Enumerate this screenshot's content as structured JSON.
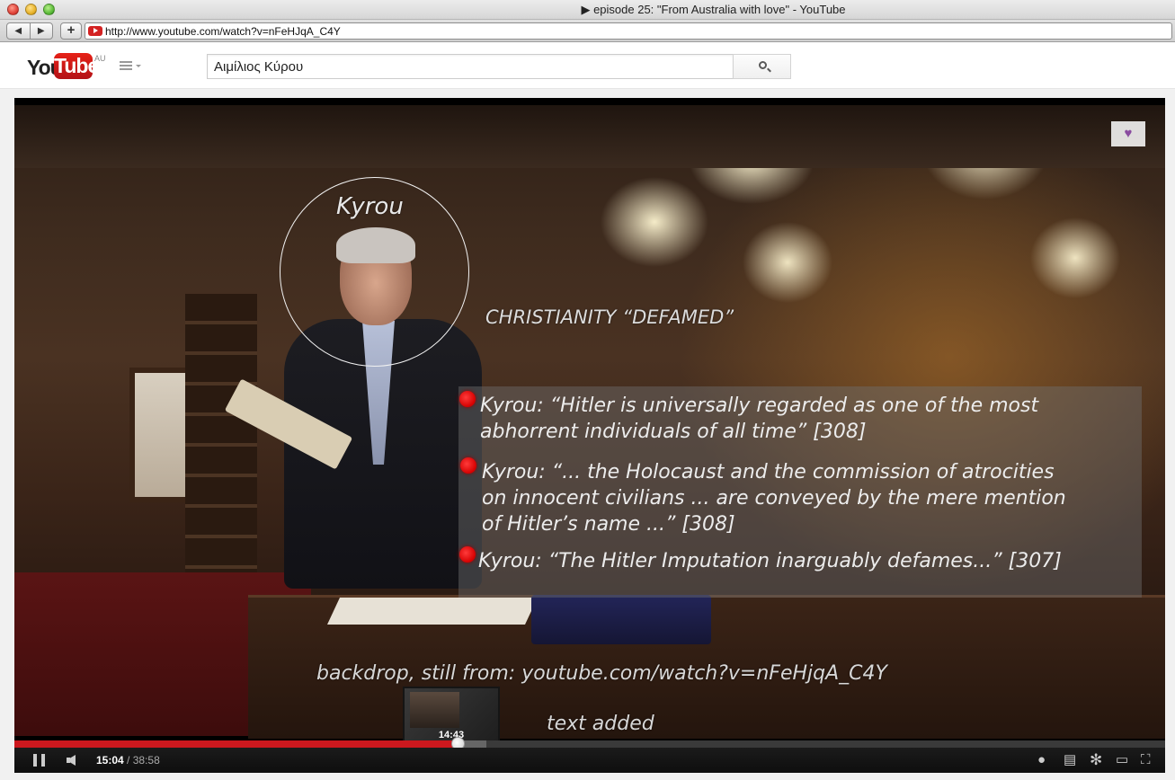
{
  "window": {
    "title": "▶ episode 25: \"From Australia with love\" - YouTube"
  },
  "browser": {
    "back": "◀",
    "forward": "▶",
    "add": "+",
    "url": "http://www.youtube.com/watch?v=nFeHJqA_C4Y"
  },
  "youtube": {
    "logo_you": "You",
    "logo_tube": "Tube",
    "region": "AU",
    "search_value": "Αιμίλιος Κύρου"
  },
  "overlay": {
    "name": "Kyrou",
    "heading": "CHRISTIANITY “DEFAMED”",
    "quotes": [
      {
        "line1": "Kyrou: “Hitler is universally regarded as one of the most",
        "line2": "abhorrent individuals of all time” [308]",
        "line3": ""
      },
      {
        "line1": "Kyrou: “... the Holocaust and the commission of atrocities",
        "line2": "on innocent civilians ... are conveyed by the mere mention",
        "line3": "of Hitler’s name ...” [308]"
      },
      {
        "line1": "Kyrou: “The Hitler Imputation inarguably defames...” [307]",
        "line2": "",
        "line3": ""
      }
    ],
    "backdrop": "backdrop, still from: youtube.com/watch?v=nFeHjqA_C4Y",
    "added": "text added",
    "badge_icon": "heart-icon"
  },
  "player": {
    "current_time": "15:04",
    "separator": " / ",
    "duration": "38:58",
    "preview_time": "14:43",
    "played_fraction": 0.386,
    "loaded_fraction": 0.41,
    "controls": [
      "pause-icon",
      "volume-icon",
      "watch-later-icon",
      "captions-icon",
      "settings-gear-icon",
      "theater-mode-icon",
      "fullscreen-icon"
    ]
  },
  "colors": {
    "progress_played": "#cc181e",
    "bullet": "#e00000",
    "youtube_red": "#e62117"
  }
}
